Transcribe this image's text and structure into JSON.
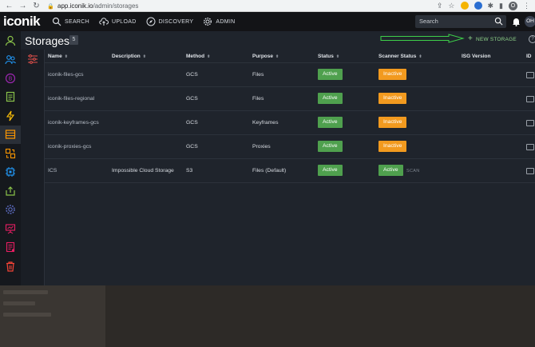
{
  "browser": {
    "url_host": "app.iconik.io",
    "url_path": "/admin/storages",
    "profile_initial": "O"
  },
  "topbar": {
    "logo": "iconik",
    "nav": [
      {
        "label": "SEARCH",
        "icon": "search-icon"
      },
      {
        "label": "UPLOAD",
        "icon": "upload-cloud-icon"
      },
      {
        "label": "DISCOVERY",
        "icon": "compass-icon"
      },
      {
        "label": "ADMIN",
        "icon": "gear-icon"
      }
    ],
    "search_placeholder": "Search",
    "user_initials": "OH"
  },
  "sidebar": {
    "items": [
      {
        "icon": "user-icon",
        "color": "#8bc34a"
      },
      {
        "icon": "users-icon",
        "color": "#2196f3"
      },
      {
        "icon": "coin-icon",
        "color": "#9c27b0"
      },
      {
        "icon": "document-icon",
        "color": "#8bc34a"
      },
      {
        "icon": "lightning-icon",
        "color": "#ffc107"
      },
      {
        "icon": "storage-icon",
        "color": "#ff9800"
      },
      {
        "icon": "transfer-icon",
        "color": "#ff9800"
      },
      {
        "icon": "chip-icon",
        "color": "#2196f3"
      },
      {
        "icon": "export-icon",
        "color": "#8bc34a"
      },
      {
        "icon": "settings-icon",
        "color": "#3f51b5"
      },
      {
        "icon": "presentation-icon",
        "color": "#e91e63"
      },
      {
        "icon": "report-icon",
        "color": "#e91e63"
      },
      {
        "icon": "trash-icon",
        "color": "#f44336"
      }
    ]
  },
  "page": {
    "title": "Storages",
    "count": "5",
    "new_storage_label": "NEW STORAGE",
    "help": "?"
  },
  "table": {
    "columns": [
      "Name",
      "Description",
      "Method",
      "Purpose",
      "Status",
      "Scanner Status",
      "ISG Version",
      "ID"
    ],
    "rows": [
      {
        "name": "iconik-files-gcs",
        "description": "",
        "method": "GCS",
        "purpose": "Files",
        "status": "Active",
        "scanner": "Inactive",
        "scan": ""
      },
      {
        "name": "iconik-files-regional",
        "description": "",
        "method": "GCS",
        "purpose": "Files",
        "status": "Active",
        "scanner": "Inactive",
        "scan": ""
      },
      {
        "name": "iconik-keyframes-gcs",
        "description": "",
        "method": "GCS",
        "purpose": "Keyframes",
        "status": "Active",
        "scanner": "Inactive",
        "scan": ""
      },
      {
        "name": "iconik-proxies-gcs",
        "description": "",
        "method": "GCS",
        "purpose": "Proxies",
        "status": "Active",
        "scanner": "Inactive",
        "scan": ""
      },
      {
        "name": "ICS",
        "description": "Impossible Cloud Storage",
        "method": "S3",
        "purpose": "Files (Default)",
        "status": "Active",
        "scanner": "Active",
        "scan": "SCAN"
      }
    ]
  },
  "colors": {
    "active": "#4fa04e",
    "inactive": "#f29a1f",
    "accent_green": "#8fd48a"
  }
}
